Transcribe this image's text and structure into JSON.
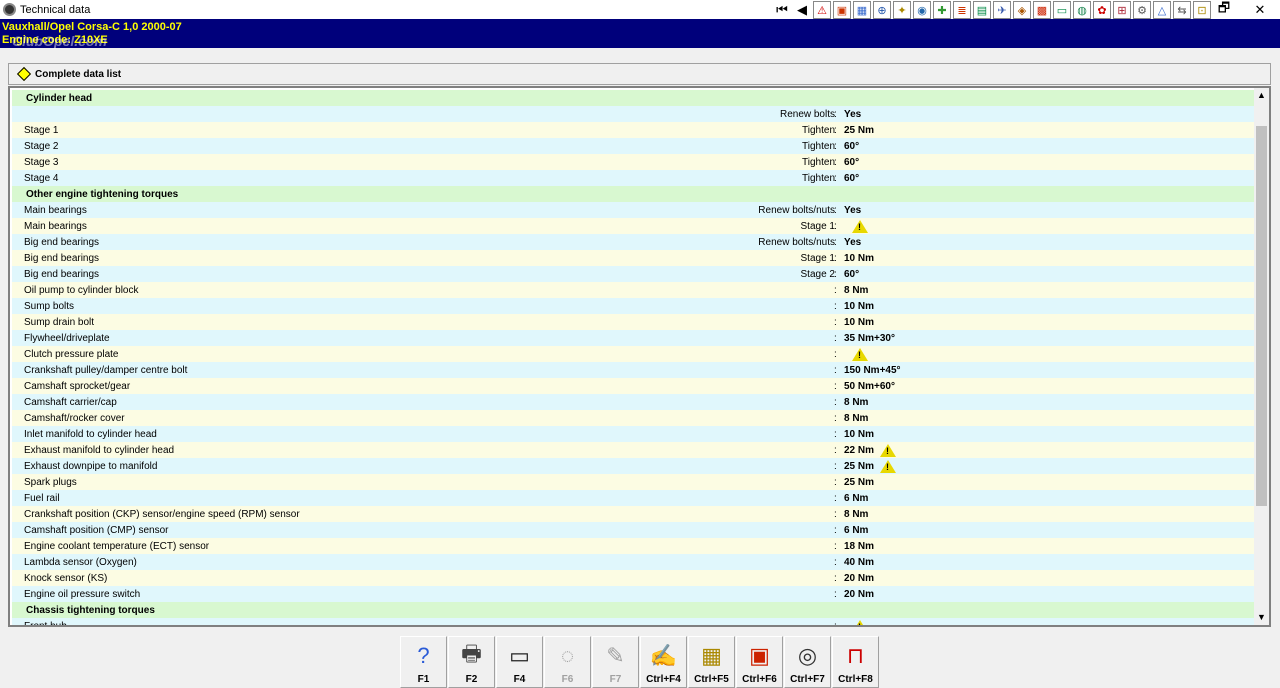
{
  "window": {
    "title": "Technical data",
    "restore_glyph": "🗗",
    "close_glyph": "✕"
  },
  "toolbar": [
    {
      "name": "first-record-button",
      "glyph": "⏮",
      "style": "nav"
    },
    {
      "name": "previous-record-button",
      "glyph": "◀",
      "style": "nav"
    },
    {
      "name": "warning-icon",
      "glyph": "⚠",
      "style": "pic",
      "color": "#d00000"
    },
    {
      "name": "tool-icon-2",
      "glyph": "▣",
      "style": "pic",
      "color": "#cc3300"
    },
    {
      "name": "tool-icon-3",
      "glyph": "▦",
      "style": "pic",
      "color": "#3366cc"
    },
    {
      "name": "tool-icon-4",
      "glyph": "⊕",
      "style": "pic",
      "color": "#2255aa"
    },
    {
      "name": "tool-icon-5",
      "glyph": "✦",
      "style": "pic",
      "color": "#aa8800"
    },
    {
      "name": "tool-icon-6",
      "glyph": "◉",
      "style": "pic",
      "color": "#2266aa"
    },
    {
      "name": "tool-icon-7",
      "glyph": "✚",
      "style": "pic",
      "color": "#339933"
    },
    {
      "name": "tool-icon-8",
      "glyph": "≣",
      "style": "pic",
      "color": "#cc3300"
    },
    {
      "name": "tool-icon-9",
      "glyph": "▤",
      "style": "pic",
      "color": "#008844"
    },
    {
      "name": "tool-icon-10",
      "glyph": "✈",
      "style": "pic",
      "color": "#3355aa"
    },
    {
      "name": "tool-icon-11",
      "glyph": "◈",
      "style": "pic",
      "color": "#aa5500"
    },
    {
      "name": "tool-icon-12",
      "glyph": "▩",
      "style": "pic",
      "color": "#cc2200"
    },
    {
      "name": "tool-icon-13",
      "glyph": "▭",
      "style": "pic",
      "color": "#008844"
    },
    {
      "name": "tool-icon-14",
      "glyph": "◍",
      "style": "pic",
      "color": "#228855"
    },
    {
      "name": "tool-icon-15",
      "glyph": "✿",
      "style": "pic",
      "color": "#cc0000"
    },
    {
      "name": "tool-icon-16",
      "glyph": "⊞",
      "style": "pic",
      "color": "#aa2233"
    },
    {
      "name": "tool-icon-17",
      "glyph": "⚙",
      "style": "pic",
      "color": "#555555"
    },
    {
      "name": "tool-icon-18",
      "glyph": "△",
      "style": "pic",
      "color": "#3366cc"
    },
    {
      "name": "tool-icon-19",
      "glyph": "⇆",
      "style": "pic",
      "color": "#555555"
    },
    {
      "name": "tool-icon-20",
      "glyph": "⊡",
      "style": "pic",
      "color": "#aa8800"
    }
  ],
  "vehicle": {
    "line1": "Vauxhall/Opel  Corsa-C  1,0  2000-07",
    "line2": "Engine code: Z10XE",
    "watermark": "ClubOpel.com"
  },
  "section": {
    "label": "Complete data list"
  },
  "rows": [
    {
      "kind": "head",
      "name": "Cylinder head"
    },
    {
      "kind": "item",
      "name": "",
      "label": "Renew bolts",
      "value": "Yes",
      "warn": false
    },
    {
      "kind": "item",
      "name": "Stage 1",
      "label": "Tighten",
      "value": "25 Nm",
      "warn": false
    },
    {
      "kind": "item",
      "name": "Stage 2",
      "label": "Tighten",
      "value": "60°",
      "warn": false
    },
    {
      "kind": "item",
      "name": "Stage 3",
      "label": "Tighten",
      "value": "60°",
      "warn": false
    },
    {
      "kind": "item",
      "name": "Stage 4",
      "label": "Tighten",
      "value": "60°",
      "warn": false
    },
    {
      "kind": "head",
      "name": "Other engine tightening torques"
    },
    {
      "kind": "item",
      "name": "Main bearings",
      "label": "Renew bolts/nuts",
      "value": "Yes",
      "warn": false
    },
    {
      "kind": "item",
      "name": "Main bearings",
      "label": "Stage 1",
      "value": "",
      "warn": true
    },
    {
      "kind": "item",
      "name": "Big end bearings",
      "label": "Renew bolts/nuts",
      "value": "Yes",
      "warn": false
    },
    {
      "kind": "item",
      "name": "Big end bearings",
      "label": "Stage 1",
      "value": "10 Nm",
      "warn": false
    },
    {
      "kind": "item",
      "name": "Big end bearings",
      "label": "Stage 2",
      "value": "60°",
      "warn": false
    },
    {
      "kind": "item",
      "name": "Oil pump to cylinder block",
      "label": "",
      "value": "8 Nm",
      "warn": false
    },
    {
      "kind": "item",
      "name": "Sump bolts",
      "label": "",
      "value": "10 Nm",
      "warn": false
    },
    {
      "kind": "item",
      "name": "Sump drain bolt",
      "label": "",
      "value": "10 Nm",
      "warn": false
    },
    {
      "kind": "item",
      "name": "Flywheel/driveplate",
      "label": "",
      "value": "35 Nm+30°",
      "warn": false
    },
    {
      "kind": "item",
      "name": "Clutch pressure plate",
      "label": "",
      "value": "",
      "warn": true
    },
    {
      "kind": "item",
      "name": "Crankshaft pulley/damper centre bolt",
      "label": "",
      "value": "150 Nm+45°",
      "warn": false
    },
    {
      "kind": "item",
      "name": "Camshaft sprocket/gear",
      "label": "",
      "value": "50 Nm+60°",
      "warn": false
    },
    {
      "kind": "item",
      "name": "Camshaft carrier/cap",
      "label": "",
      "value": "8 Nm",
      "warn": false
    },
    {
      "kind": "item",
      "name": "Camshaft/rocker cover",
      "label": "",
      "value": "8 Nm",
      "warn": false
    },
    {
      "kind": "item",
      "name": "Inlet manifold to cylinder head",
      "label": "",
      "value": "10 Nm",
      "warn": false
    },
    {
      "kind": "item",
      "name": "Exhaust manifold to cylinder head",
      "label": "",
      "value": "22 Nm",
      "warn": true
    },
    {
      "kind": "item",
      "name": "Exhaust downpipe to manifold",
      "label": "",
      "value": "25 Nm",
      "warn": true
    },
    {
      "kind": "item",
      "name": "Spark plugs",
      "label": "",
      "value": "25 Nm",
      "warn": false
    },
    {
      "kind": "item",
      "name": "Fuel rail",
      "label": "",
      "value": "6 Nm",
      "warn": false
    },
    {
      "kind": "item",
      "name": "Crankshaft position (CKP) sensor/engine speed (RPM) sensor",
      "label": "",
      "value": "8 Nm",
      "warn": false
    },
    {
      "kind": "item",
      "name": "Camshaft position (CMP) sensor",
      "label": "",
      "value": "6 Nm",
      "warn": false
    },
    {
      "kind": "item",
      "name": "Engine coolant temperature (ECT) sensor",
      "label": "",
      "value": "18 Nm",
      "warn": false
    },
    {
      "kind": "item",
      "name": "Lambda sensor (Oxygen)",
      "label": "",
      "value": "40 Nm",
      "warn": false
    },
    {
      "kind": "item",
      "name": "Knock sensor (KS)",
      "label": "",
      "value": "20 Nm",
      "warn": false
    },
    {
      "kind": "item",
      "name": "Engine oil pressure switch",
      "label": "",
      "value": "20 Nm",
      "warn": false
    },
    {
      "kind": "head",
      "name": "Chassis tightening torques"
    },
    {
      "kind": "item",
      "name": "Front hub",
      "label": "",
      "value": "",
      "warn": true
    }
  ],
  "scrollbar": {
    "up_glyph": "▲",
    "down_glyph": "▼",
    "position_fraction": 0.18,
    "visible_fraction": 0.75
  },
  "fkeys": [
    {
      "name": "help-button",
      "label": "F1",
      "glyph": "?",
      "color": "#2a5bd7",
      "disabled": false
    },
    {
      "name": "print-button",
      "label": "F2",
      "glyph": "🖶",
      "color": "#444444",
      "disabled": false
    },
    {
      "name": "display-button",
      "label": "F4",
      "glyph": "▭",
      "color": "#222222",
      "disabled": false
    },
    {
      "name": "f6-button",
      "label": "F6",
      "glyph": "◌",
      "color": "#a0a0a0",
      "disabled": true
    },
    {
      "name": "f7-button",
      "label": "F7",
      "glyph": "✎",
      "color": "#a0a0a0",
      "disabled": true
    },
    {
      "name": "notes-button",
      "label": "Ctrl+F4",
      "glyph": "✍",
      "color": "#444444",
      "disabled": false
    },
    {
      "name": "lubricants-button",
      "label": "Ctrl+F5",
      "glyph": "▦",
      "color": "#aa8800",
      "disabled": false
    },
    {
      "name": "calendar-button",
      "label": "Ctrl+F6",
      "glyph": "▣",
      "color": "#cc2200",
      "disabled": false
    },
    {
      "name": "diagnostics-button",
      "label": "Ctrl+F7",
      "glyph": "◎",
      "color": "#333333",
      "disabled": false
    },
    {
      "name": "lift-points-button",
      "label": "Ctrl+F8",
      "glyph": "⊓",
      "color": "#cc0000",
      "disabled": false
    }
  ]
}
